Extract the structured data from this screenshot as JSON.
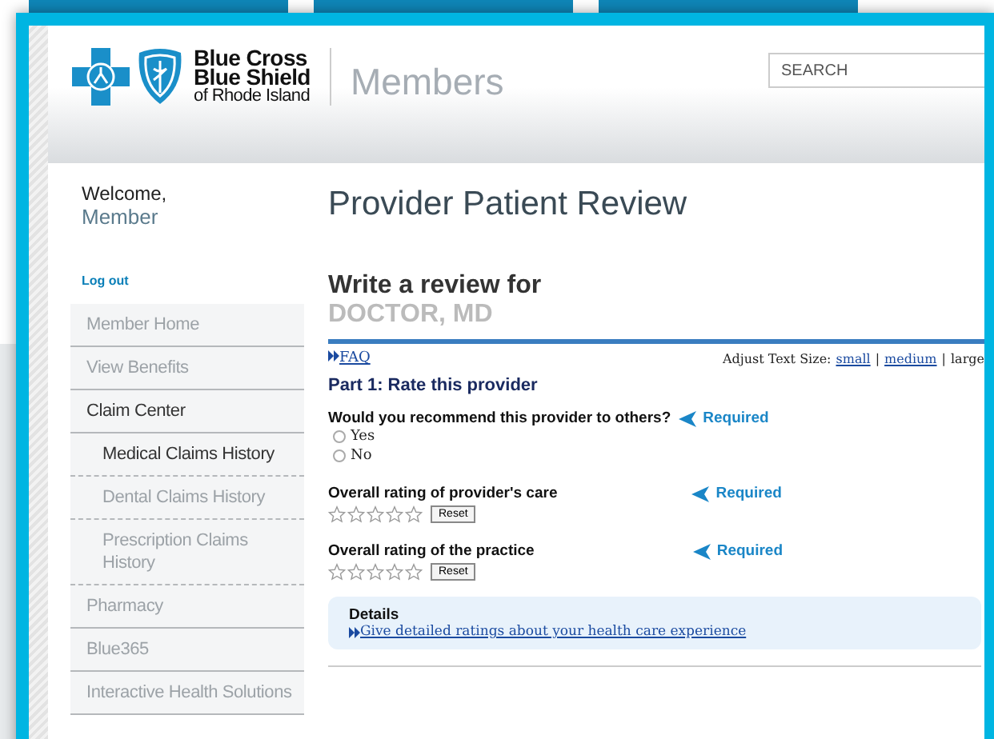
{
  "header": {
    "logo_lines": [
      "Blue Cross",
      "Blue Shield",
      "of Rhode Island"
    ],
    "section": "Members",
    "search": {
      "placeholder": "SEARCH"
    }
  },
  "sidebar": {
    "welcome": "Welcome,",
    "user": "Member",
    "logout": "Log out",
    "items": [
      {
        "label": "Member Home",
        "expanded": false
      },
      {
        "label": "View Benefits",
        "expanded": false
      },
      {
        "label": "Claim Center",
        "expanded": true,
        "children": [
          {
            "label": "Medical Claims History",
            "selected": true
          },
          {
            "label": "Dental Claims History",
            "selected": false
          },
          {
            "label": "Prescription Claims History",
            "selected": false
          }
        ]
      },
      {
        "label": "Pharmacy",
        "expanded": false
      },
      {
        "label": "Blue365",
        "expanded": false
      },
      {
        "label": "Interactive Health Solutions",
        "expanded": false
      }
    ]
  },
  "main": {
    "title": "Provider Patient Review",
    "review_for": "Write a review for",
    "provider": "DOCTOR, MD",
    "faq": "FAQ",
    "text_size": {
      "label": "Adjust Text Size:",
      "separator": "|",
      "options": [
        "small",
        "medium",
        "large"
      ]
    },
    "part1": "Part 1: Rate this provider",
    "questions": [
      {
        "kind": "radio",
        "label": "Would you recommend this provider to others?",
        "required": "Required",
        "options": [
          {
            "label": "Yes",
            "selected": false
          },
          {
            "label": "No",
            "selected": false
          }
        ]
      },
      {
        "kind": "stars",
        "label": "Overall rating of provider's care",
        "required": "Required",
        "stars": 0,
        "reset": "Reset"
      },
      {
        "kind": "stars",
        "label": "Overall rating of the practice",
        "required": "Required",
        "stars": 0,
        "reset": "Reset"
      }
    ],
    "details": {
      "title": "Details",
      "link": "Give detailed ratings about your health care experience"
    }
  }
}
